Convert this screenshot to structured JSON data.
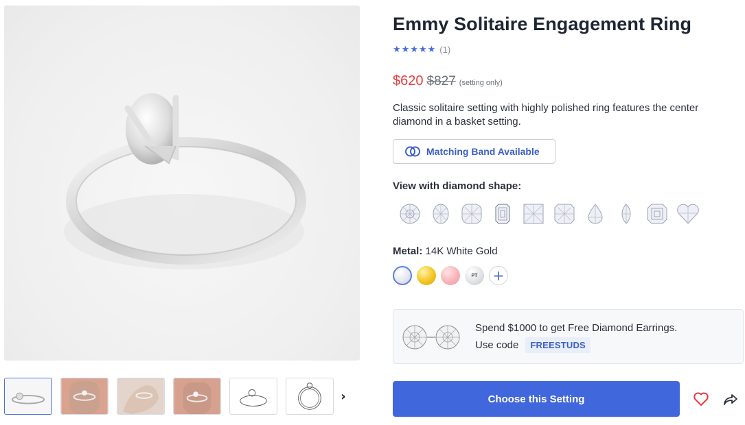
{
  "product": {
    "title": "Emmy Solitaire Engagement Ring",
    "rating_stars": 5,
    "review_count": "(1)",
    "price": "$620",
    "old_price": "$827",
    "price_note": "(setting only)",
    "description": "Classic solitaire setting with highly polished ring features the center diamond in a basket setting."
  },
  "matching_band": {
    "label": "Matching Band Available",
    "icon": "interlocking-rings-icon"
  },
  "shapes": {
    "heading": "View with diamond shape:",
    "items": [
      "round",
      "oval",
      "cushion",
      "emerald",
      "princess",
      "radiant",
      "pear",
      "marquise",
      "asscher",
      "heart"
    ]
  },
  "metal": {
    "label": "Metal:",
    "value": "14K White Gold",
    "swatches": [
      {
        "name": "white-gold",
        "color": "#e6e8ee",
        "selected": true
      },
      {
        "name": "yellow-gold",
        "color": "#f3c521"
      },
      {
        "name": "rose-gold",
        "color": "#f7b4b7"
      },
      {
        "name": "platinum",
        "color": "#e2e3e6",
        "text": "PT"
      },
      {
        "name": "more",
        "text": "+"
      }
    ]
  },
  "promo": {
    "text": "Spend $1000 to get Free Diamond Earrings.",
    "code_label": "Use code",
    "code": "FREESTUDS"
  },
  "actions": {
    "cta": "Choose this Setting",
    "wishlist_icon": "heart-icon",
    "share_icon": "share-icon"
  },
  "gallery": {
    "thumbnails": [
      "ring-side",
      "hand-front",
      "hand-back",
      "hand-angle",
      "ring-sketch",
      "ring-sketch-front"
    ],
    "active_index": 0,
    "next_icon": "chevron-right-icon",
    "next_glyph": "›"
  },
  "colors": {
    "accent": "#4167dc",
    "price": "#e43c3c",
    "text": "#1d2533"
  }
}
